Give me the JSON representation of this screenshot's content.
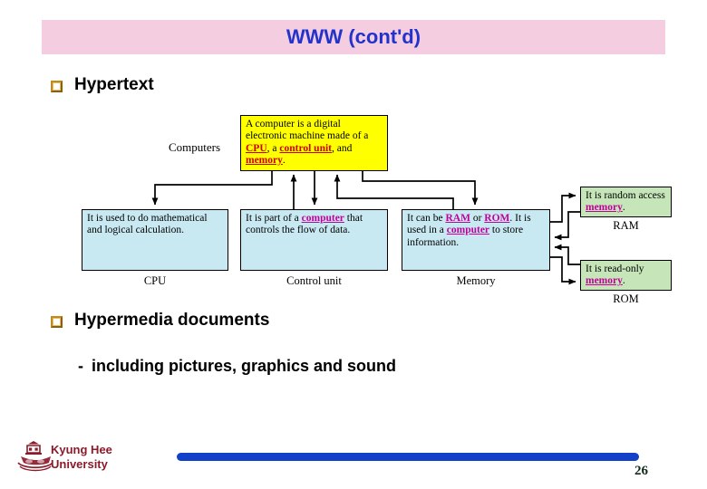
{
  "slide": {
    "title": "WWW (cont'd)",
    "title_color": "#2233cc",
    "title_bar_color": "#f4cde0"
  },
  "bullets": [
    {
      "id": "hypertext",
      "glyph": "gold-square-bullet",
      "label": "Hypertext"
    },
    {
      "id": "hypermedia",
      "glyph": "gold-square-bullet",
      "label": "Hypermedia documents"
    }
  ],
  "sub_bullet": {
    "dash": "-",
    "label": "including pictures, graphics and sound"
  },
  "diagram": {
    "source_label": "Computers",
    "colors": {
      "root": "#ffff00",
      "child": "#c9e9f2",
      "leaf": "#c6e6b9",
      "link": "#d00000",
      "visited_link": "#c0009a"
    },
    "nodes": {
      "root": {
        "caption": "",
        "text_runs": [
          {
            "t": "A computer is a digital electronic machine made of a ",
            "style": "plain"
          },
          {
            "t": "CPU",
            "style": "link"
          },
          {
            "t": ", a ",
            "style": "plain"
          },
          {
            "t": "control unit",
            "style": "link"
          },
          {
            "t": ", and ",
            "style": "plain"
          },
          {
            "t": "memory",
            "style": "link"
          },
          {
            "t": ".",
            "style": "plain"
          }
        ]
      },
      "cpu": {
        "caption": "CPU",
        "text_runs": [
          {
            "t": "It is used to do mathematical and logical calculation.",
            "style": "plain"
          }
        ]
      },
      "control_unit": {
        "caption": "Control unit",
        "text_runs": [
          {
            "t": "It is part of a ",
            "style": "plain"
          },
          {
            "t": "computer",
            "style": "visited"
          },
          {
            "t": " that controls the flow of data.",
            "style": "plain"
          }
        ]
      },
      "memory": {
        "caption": "Memory",
        "text_runs": [
          {
            "t": "It can be ",
            "style": "plain"
          },
          {
            "t": "RAM",
            "style": "visited"
          },
          {
            "t": " or ",
            "style": "plain"
          },
          {
            "t": "ROM",
            "style": "visited"
          },
          {
            "t": ". It is used in a ",
            "style": "plain"
          },
          {
            "t": "computer",
            "style": "visited"
          },
          {
            "t": " to store information.",
            "style": "plain"
          }
        ]
      },
      "ram": {
        "caption": "RAM",
        "text_runs": [
          {
            "t": "It is random access ",
            "style": "plain"
          },
          {
            "t": "memory",
            "style": "visited"
          },
          {
            "t": ".",
            "style": "plain"
          }
        ]
      },
      "rom": {
        "caption": "ROM",
        "text_runs": [
          {
            "t": "It is read-only ",
            "style": "plain"
          },
          {
            "t": "memory",
            "style": "visited"
          },
          {
            "t": ".",
            "style": "plain"
          }
        ]
      }
    }
  },
  "footer": {
    "logo": "kyung-hee-university-emblem",
    "university": "Kyung Hee\nUniversity",
    "university_color": "#8b1a2b",
    "bar_color": "#1340c8",
    "page_number": "26"
  }
}
